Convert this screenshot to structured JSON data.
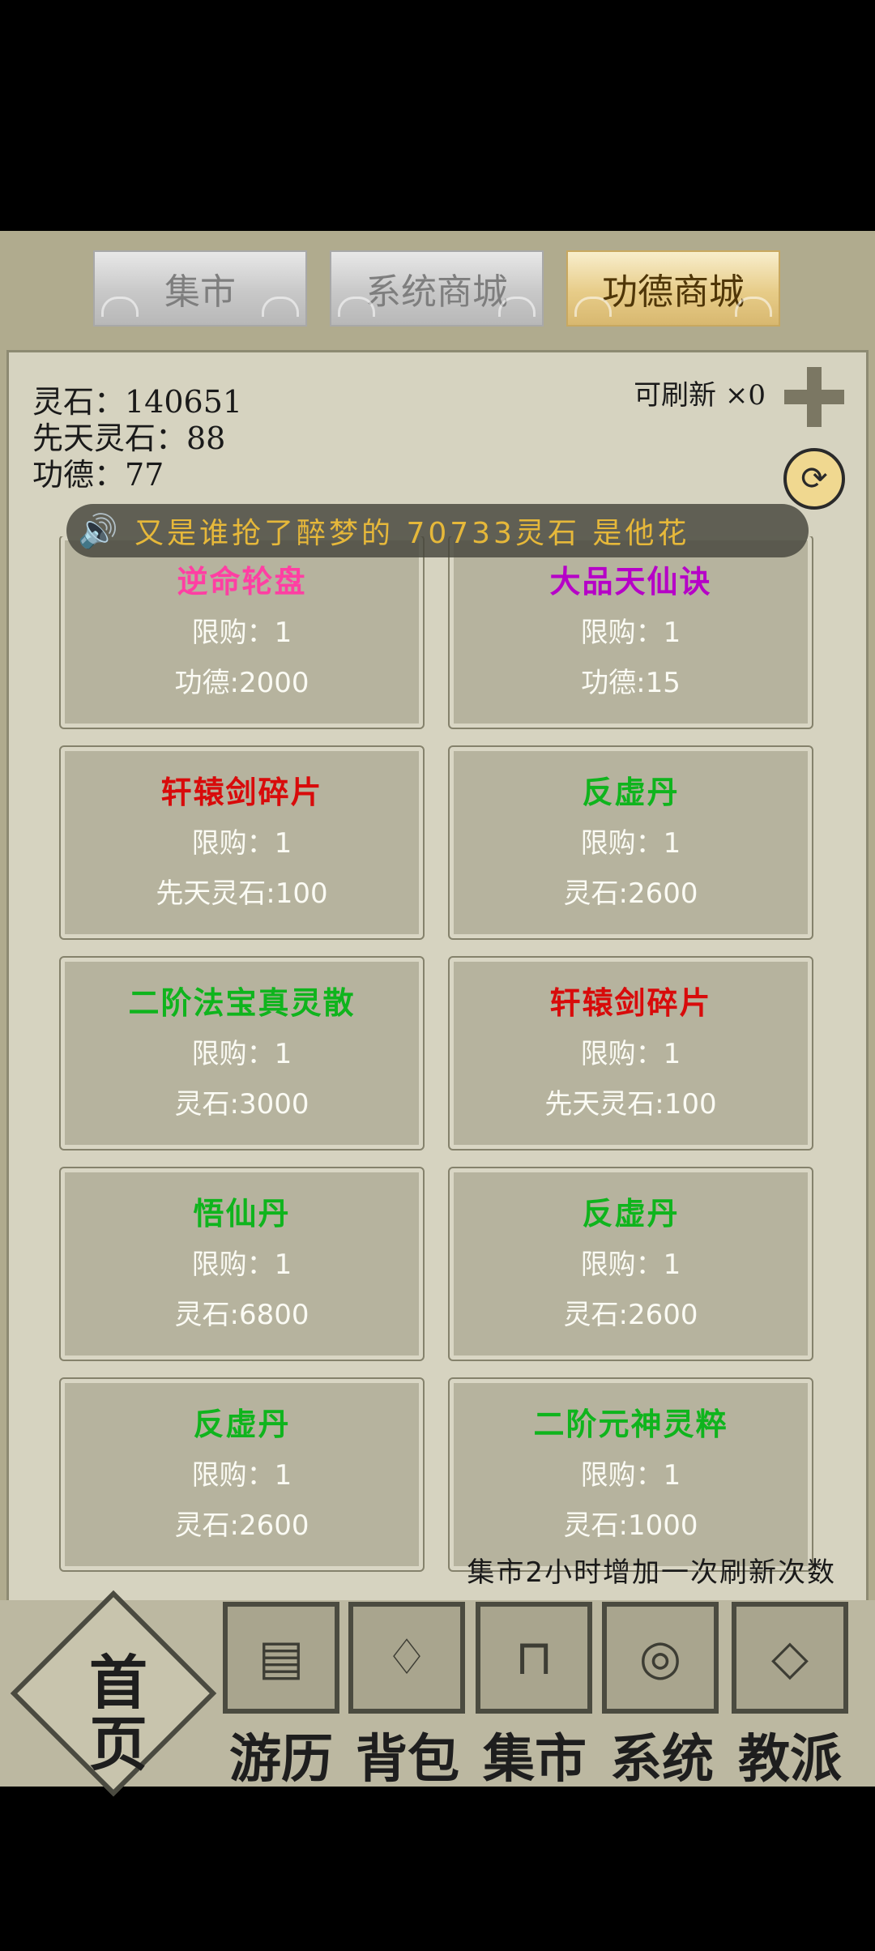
{
  "tabs": [
    {
      "label": "集市",
      "active": false
    },
    {
      "label": "系统商城",
      "active": false
    },
    {
      "label": "功德商城",
      "active": true
    }
  ],
  "stats": {
    "lingshi": "灵石：140651",
    "xiantian": "先天灵石：88",
    "gongde": "功德：77"
  },
  "refresh": {
    "label": "可刷新 ×0"
  },
  "marquee": {
    "text": "又是谁抢了醉梦的 70733灵石  是他花"
  },
  "items": [
    {
      "name": "逆命轮盘",
      "limit": "限购：1",
      "price": "功德:2000",
      "color": "#ff3fa3"
    },
    {
      "name": "大品天仙诀",
      "limit": "限购：1",
      "price": "功德:15",
      "color": "#b600c8"
    },
    {
      "name": "轩辕剑碎片",
      "limit": "限购：1",
      "price": "先天灵石:100",
      "color": "#d80b0b"
    },
    {
      "name": "反虚丹",
      "limit": "限购：1",
      "price": "灵石:2600",
      "color": "#0fb41d"
    },
    {
      "name": "二阶法宝真灵散",
      "limit": "限购：1",
      "price": "灵石:3000",
      "color": "#0fb41d"
    },
    {
      "name": "轩辕剑碎片",
      "limit": "限购：1",
      "price": "先天灵石:100",
      "color": "#d80b0b"
    },
    {
      "name": "悟仙丹",
      "limit": "限购：1",
      "price": "灵石:6800",
      "color": "#0fb41d"
    },
    {
      "name": "反虚丹",
      "limit": "限购：1",
      "price": "灵石:2600",
      "color": "#0fb41d"
    },
    {
      "name": "反虚丹",
      "limit": "限购：1",
      "price": "灵石:2600",
      "color": "#0fb41d"
    },
    {
      "name": "二阶元神灵粹",
      "limit": "限购：1",
      "price": "灵石:1000",
      "color": "#0fb41d"
    }
  ],
  "note": "集市2小时增加一次刷新次数",
  "nav": {
    "home": [
      "首",
      "页"
    ],
    "items": [
      {
        "label": "游历",
        "icon": "chest-icon"
      },
      {
        "label": "背包",
        "icon": "bag-icon"
      },
      {
        "label": "集市",
        "icon": "stall-icon"
      },
      {
        "label": "系统",
        "icon": "system-icon"
      },
      {
        "label": "教派",
        "icon": "sect-icon"
      }
    ]
  }
}
